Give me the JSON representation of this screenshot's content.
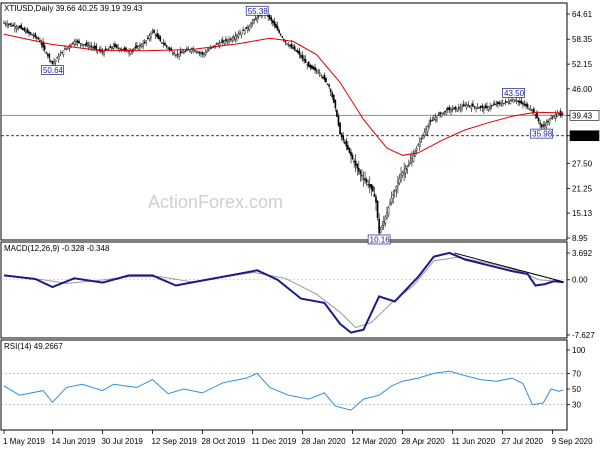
{
  "chart_data": [
    {
      "type": "candlestick",
      "title": "XTIUSD,Daily  39.66 40.25 39.19 39.43",
      "ylim": [
        8.95,
        64.61
      ],
      "y_ticks": [
        64.61,
        58.35,
        52.15,
        46.0,
        39.43,
        34.36,
        27.5,
        21.25,
        15.13,
        8.95
      ],
      "x_tick_labels": [
        "1 May 2019",
        "14 Jun 2019",
        "30 Jul 2019",
        "12 Sep 2019",
        "28 Oct 2019",
        "11 Dec 2019",
        "28 Jan 2020",
        "12 Mar 2020",
        "28 Apr 2020",
        "11 Jun 2020",
        "27 Jul 2020",
        "9 Sep 2020"
      ],
      "x_tick_index": [
        0,
        31,
        63,
        95,
        127,
        159,
        191,
        223,
        255,
        287,
        319,
        351
      ],
      "bar_count": 358,
      "current_price": "39.43",
      "horizontal_level": 34.36,
      "horizontal_level_label": "34.36",
      "price_path": [
        [
          0,
          62.4
        ],
        [
          10,
          61.2
        ],
        [
          22,
          58.4
        ],
        [
          31,
          52.3
        ],
        [
          38,
          55.5
        ],
        [
          45,
          57.8
        ],
        [
          55,
          56.6
        ],
        [
          63,
          55.1
        ],
        [
          70,
          56.6
        ],
        [
          80,
          55.3
        ],
        [
          90,
          57.4
        ],
        [
          95,
          60.4
        ],
        [
          100,
          57.9
        ],
        [
          110,
          54.4
        ],
        [
          120,
          56.0
        ],
        [
          127,
          54.6
        ],
        [
          135,
          56.9
        ],
        [
          145,
          58.4
        ],
        [
          155,
          60.9
        ],
        [
          162,
          63.8
        ],
        [
          167,
          65.0
        ],
        [
          172,
          62.4
        ],
        [
          180,
          57.6
        ],
        [
          188,
          55.0
        ],
        [
          195,
          51.5
        ],
        [
          202,
          50.0
        ],
        [
          208,
          46.6
        ],
        [
          212,
          41.3
        ],
        [
          215,
          34.8
        ],
        [
          220,
          31.0
        ],
        [
          225,
          27.0
        ],
        [
          228,
          24.8
        ],
        [
          232,
          22.8
        ],
        [
          236,
          20.6
        ],
        [
          238,
          17.8
        ],
        [
          240,
          10.2
        ],
        [
          243,
          13.0
        ],
        [
          248,
          18.9
        ],
        [
          254,
          24.7
        ],
        [
          260,
          27.8
        ],
        [
          266,
          33.0
        ],
        [
          272,
          37.5
        ],
        [
          278,
          39.5
        ],
        [
          284,
          40.8
        ],
        [
          290,
          41.0
        ],
        [
          296,
          42.0
        ],
        [
          302,
          41.5
        ],
        [
          308,
          41.2
        ],
        [
          314,
          42.1
        ],
        [
          320,
          42.5
        ],
        [
          326,
          43.4
        ],
        [
          332,
          42.2
        ],
        [
          338,
          40.8
        ],
        [
          342,
          38.0
        ],
        [
          344,
          36.5
        ],
        [
          346,
          37.2
        ],
        [
          350,
          38.6
        ],
        [
          354,
          40.1
        ],
        [
          356,
          39.5
        ],
        [
          358,
          39.4
        ]
      ],
      "sma_path": [
        [
          0,
          59.6
        ],
        [
          30,
          57.1
        ],
        [
          60,
          55.6
        ],
        [
          90,
          55.5
        ],
        [
          120,
          55.8
        ],
        [
          150,
          57.2
        ],
        [
          170,
          58.6
        ],
        [
          185,
          57.8
        ],
        [
          200,
          54.5
        ],
        [
          215,
          47.6
        ],
        [
          230,
          38.4
        ],
        [
          245,
          31.3
        ],
        [
          255,
          29.5
        ],
        [
          265,
          30.1
        ],
        [
          280,
          33.2
        ],
        [
          295,
          35.8
        ],
        [
          310,
          37.6
        ],
        [
          325,
          39.2
        ],
        [
          340,
          40.2
        ],
        [
          358,
          40.0
        ]
      ],
      "annotations": [
        {
          "text": "55.38",
          "index": 162,
          "value": 63.8
        },
        {
          "text": "50.64",
          "index": 31,
          "value": 52.3
        },
        {
          "text": "10.16",
          "index": 240,
          "value": 10.2
        },
        {
          "text": "43.50",
          "index": 326,
          "value": 43.4
        },
        {
          "text": "35.98",
          "index": 344,
          "value": 36.5
        }
      ]
    },
    {
      "type": "line",
      "title": "MACD(12,26,9) -0.328 -0.348",
      "ylim": [
        -7.627,
        3.692
      ],
      "y_ticks": [
        3.692,
        0.0,
        -7.627
      ],
      "series_path": [
        [
          0,
          0.6
        ],
        [
          20,
          0.1
        ],
        [
          31,
          -1.0
        ],
        [
          45,
          0.2
        ],
        [
          63,
          -0.4
        ],
        [
          80,
          0.6
        ],
        [
          95,
          0.6
        ],
        [
          110,
          -0.8
        ],
        [
          127,
          -0.1
        ],
        [
          145,
          0.6
        ],
        [
          162,
          1.3
        ],
        [
          175,
          0.0
        ],
        [
          190,
          -2.6
        ],
        [
          205,
          -3.2
        ],
        [
          215,
          -6.1
        ],
        [
          222,
          -7.3
        ],
        [
          230,
          -6.9
        ],
        [
          240,
          -2.3
        ],
        [
          250,
          -3.0
        ],
        [
          265,
          0.4
        ],
        [
          275,
          3.2
        ],
        [
          285,
          3.7
        ],
        [
          295,
          2.8
        ],
        [
          310,
          2.0
        ],
        [
          325,
          1.2
        ],
        [
          335,
          0.8
        ],
        [
          340,
          -0.8
        ],
        [
          346,
          -0.6
        ],
        [
          352,
          -0.2
        ],
        [
          358,
          -0.35
        ]
      ],
      "signal_path": [
        [
          0,
          0.6
        ],
        [
          25,
          0.0
        ],
        [
          40,
          -0.5
        ],
        [
          60,
          -0.1
        ],
        [
          80,
          0.4
        ],
        [
          100,
          0.4
        ],
        [
          120,
          -0.3
        ],
        [
          140,
          0.4
        ],
        [
          160,
          1.0
        ],
        [
          180,
          0.2
        ],
        [
          200,
          -2.0
        ],
        [
          215,
          -4.5
        ],
        [
          225,
          -6.6
        ],
        [
          235,
          -5.9
        ],
        [
          248,
          -3.2
        ],
        [
          262,
          -0.8
        ],
        [
          275,
          2.6
        ],
        [
          290,
          3.1
        ],
        [
          310,
          2.3
        ],
        [
          330,
          1.2
        ],
        [
          342,
          0.0
        ],
        [
          358,
          -0.3
        ]
      ],
      "trendline": [
        [
          288,
          3.7
        ],
        [
          358,
          -0.3
        ]
      ]
    },
    {
      "type": "line",
      "title": "RSI(14) 49.2667",
      "ylim": [
        0,
        100
      ],
      "y_ticks": [
        100,
        70,
        50,
        30
      ],
      "levels": [
        70,
        30
      ],
      "series_path": [
        [
          0,
          54
        ],
        [
          10,
          42
        ],
        [
          25,
          48
        ],
        [
          31,
          33
        ],
        [
          40,
          52
        ],
        [
          50,
          56
        ],
        [
          63,
          48
        ],
        [
          70,
          56
        ],
        [
          85,
          52
        ],
        [
          95,
          62
        ],
        [
          105,
          44
        ],
        [
          115,
          50
        ],
        [
          127,
          45
        ],
        [
          140,
          58
        ],
        [
          155,
          64
        ],
        [
          162,
          70
        ],
        [
          170,
          52
        ],
        [
          182,
          42
        ],
        [
          195,
          37
        ],
        [
          205,
          45
        ],
        [
          212,
          28
        ],
        [
          222,
          23
        ],
        [
          230,
          37
        ],
        [
          240,
          42
        ],
        [
          248,
          54
        ],
        [
          255,
          60
        ],
        [
          265,
          64
        ],
        [
          275,
          70
        ],
        [
          285,
          73
        ],
        [
          295,
          67
        ],
        [
          305,
          62
        ],
        [
          315,
          60
        ],
        [
          325,
          64
        ],
        [
          332,
          57
        ],
        [
          338,
          30
        ],
        [
          345,
          32
        ],
        [
          350,
          50
        ],
        [
          355,
          47
        ],
        [
          358,
          49
        ]
      ]
    }
  ],
  "watermark": "ActionForex.com"
}
